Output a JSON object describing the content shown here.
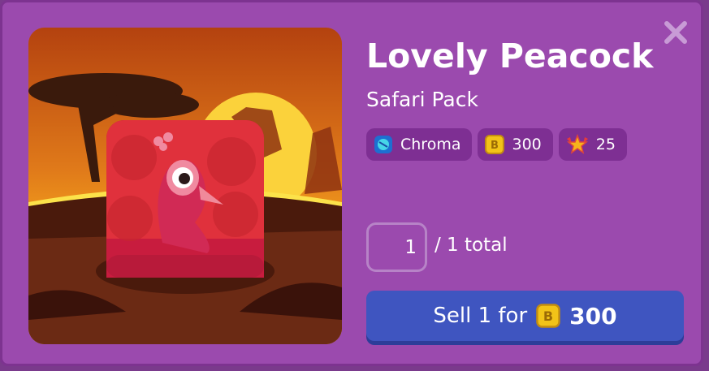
{
  "item": {
    "name": "Lovely Peacock",
    "pack": "Safari Pack"
  },
  "badges": [
    {
      "icon": "chroma-icon",
      "label": "Chroma"
    },
    {
      "icon": "token-icon",
      "label": "300"
    },
    {
      "icon": "xp-star-icon",
      "label": "25"
    }
  ],
  "quantity": {
    "value": "1",
    "total_label": "/ 1 total"
  },
  "sell_button": {
    "prefix": "Sell 1 for",
    "amount": "300",
    "icon": "token-icon"
  },
  "colors": {
    "modal_bg": "#9b4aae",
    "badge_bg": "#7e2f93",
    "button_bg": "#3f55c0",
    "token": "#f2c318"
  }
}
